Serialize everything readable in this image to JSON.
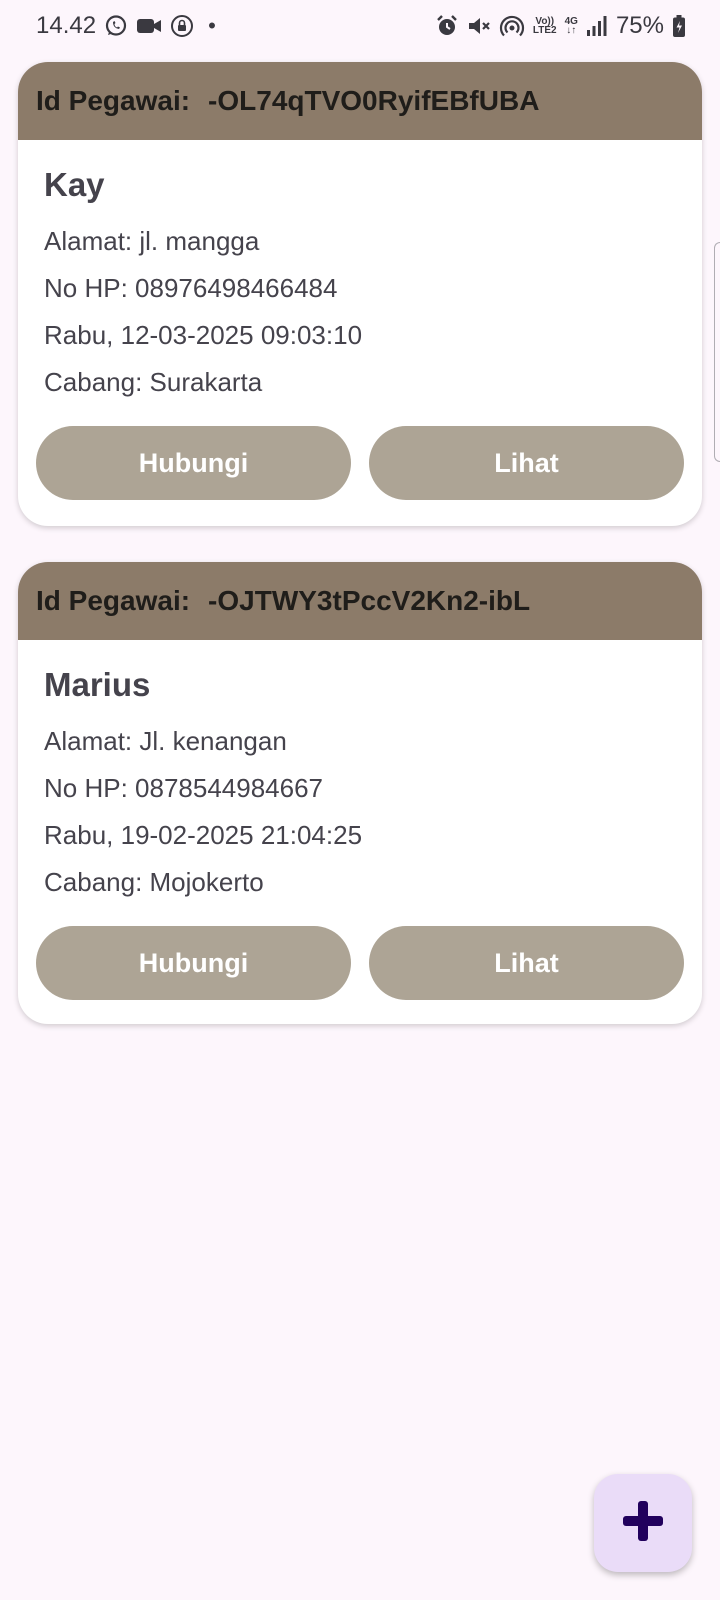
{
  "status_bar": {
    "time": "14.42",
    "left_icons": [
      "whatsapp-icon",
      "video-camera-icon",
      "lock-circle-icon"
    ],
    "dot": "•",
    "right_icons": [
      "alarm-icon",
      "mute-icon",
      "hotspot-icon",
      "volte-icon",
      "4g-icon",
      "signal-icon",
      "battery-charging-icon"
    ],
    "volte_line1": "Vo))",
    "volte_line2": "LTE2",
    "network_type": "4G",
    "battery": "75%"
  },
  "employees": [
    {
      "id_label": "Id Pegawai:",
      "id": "-OL74qTVO0RyifEBfUBA",
      "name": "Kay",
      "address": "Alamat: jl. mangga",
      "phone": "No HP: 08976498466484",
      "datetime": "Rabu, 12-03-2025 09:03:10",
      "branch": "Cabang: Surakarta",
      "contact_label": "Hubungi",
      "view_label": "Lihat"
    },
    {
      "id_label": "Id Pegawai:",
      "id": "-OJTWY3tPccV2Kn2-ibL",
      "name": "Marius",
      "address": "Alamat: Jl. kenangan",
      "phone": "No HP: 0878544984667",
      "datetime": "Rabu, 19-02-2025 21:04:25",
      "branch": "Cabang: Mojokerto",
      "contact_label": "Hubungi",
      "view_label": "Lihat"
    }
  ],
  "fab": {
    "icon": "plus-icon"
  },
  "colors": {
    "background": "#fdf6fc",
    "card_header": "#8c7b69",
    "button": "#ada495",
    "fab": "#eadcf8",
    "fab_icon": "#21005d"
  }
}
